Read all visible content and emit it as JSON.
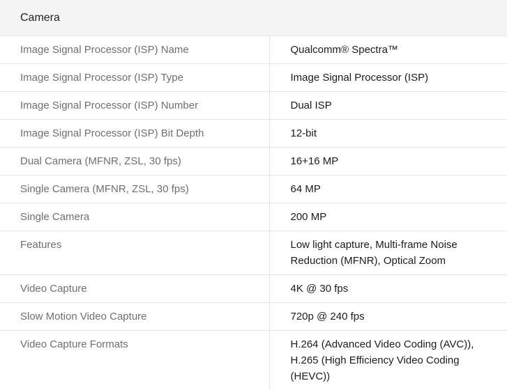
{
  "section": {
    "title": "Camera"
  },
  "rows": [
    {
      "label": "Image Signal Processor (ISP) Name",
      "value": "Qualcomm® Spectra™"
    },
    {
      "label": "Image Signal Processor (ISP) Type",
      "value": "Image Signal Processor (ISP)"
    },
    {
      "label": "Image Signal Processor (ISP) Number",
      "value": "Dual ISP"
    },
    {
      "label": "Image Signal Processor (ISP) Bit Depth",
      "value": "12-bit"
    },
    {
      "label": "Dual Camera (MFNR, ZSL, 30 fps)",
      "value": "16+16 MP"
    },
    {
      "label": "Single Camera (MFNR, ZSL, 30 fps)",
      "value": "64 MP"
    },
    {
      "label": "Single Camera",
      "value": "200 MP"
    },
    {
      "label": "Features",
      "value": "Low light capture, Multi-frame Noise Reduction (MFNR), Optical Zoom"
    },
    {
      "label": "Video Capture",
      "value": "4K @ 30 fps"
    },
    {
      "label": "Slow Motion Video Capture",
      "value": "720p @ 240 fps"
    },
    {
      "label": "Video Capture Formats",
      "value": "H.264 (Advanced Video Coding (AVC)), H.265 (High Efficiency Video Coding (HEVC))"
    }
  ]
}
